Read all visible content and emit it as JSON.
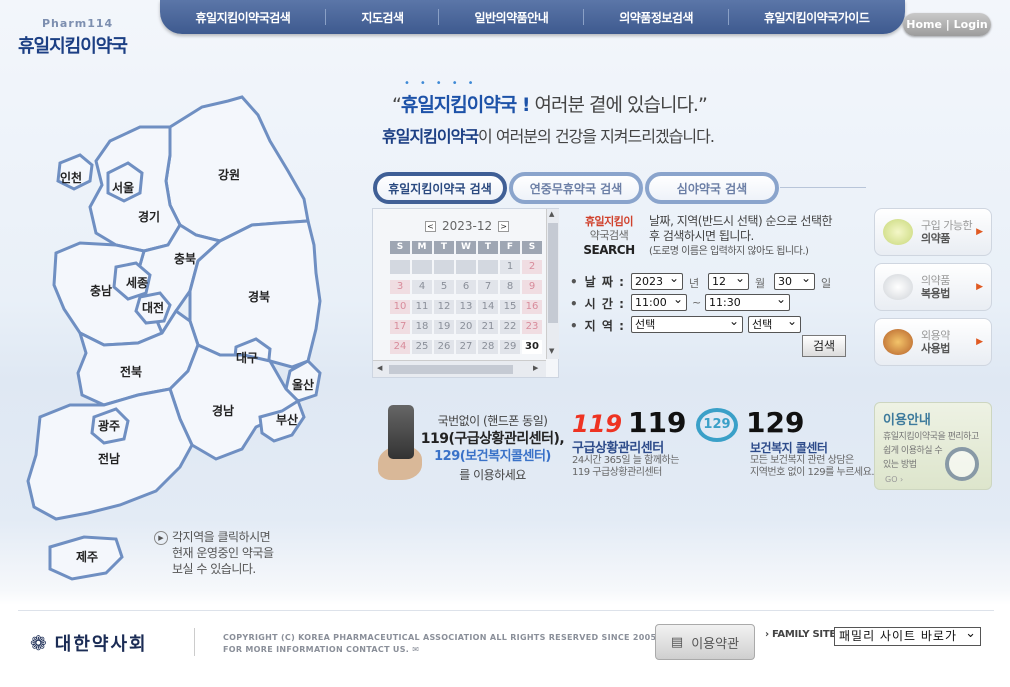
{
  "logo": {
    "sub": "Pharm114",
    "main": "휴일지킴이약국"
  },
  "nav": {
    "items": [
      "휴일지킴이약국검색",
      "지도검색",
      "일반의약품안내",
      "의약품정보검색",
      "휴일지킴이약국가이드"
    ],
    "home_login": "Home | Login"
  },
  "slogan": {
    "line1_pre": "“",
    "line1_highlight": "휴일지킴이약국 !",
    "line1_rest": " 여러분 곁에 있습니다.”",
    "line2_highlight": "휴일지킴이약국",
    "line2_rest": "이 여러분의 건강을 지켜드리겠습니다."
  },
  "tabs": [
    "휴일지킴이약국 검색",
    "연중무휴약국 검색",
    "심야약국 검색"
  ],
  "calendar": {
    "month": "2023-12",
    "prev": "<",
    "next": ">",
    "weekdays": [
      "S",
      "M",
      "T",
      "W",
      "T",
      "F",
      "S"
    ],
    "days": [
      "",
      "",
      "",
      "",
      "",
      "1",
      "2",
      "3",
      "4",
      "5",
      "6",
      "7",
      "8",
      "9",
      "10",
      "11",
      "12",
      "13",
      "14",
      "15",
      "16",
      "17",
      "18",
      "19",
      "20",
      "21",
      "22",
      "23",
      "24",
      "25",
      "26",
      "27",
      "28",
      "29",
      "30"
    ],
    "today": "30"
  },
  "search": {
    "label_l1": "휴일지킴이",
    "label_l2": "약국검색",
    "label_l3": "SEARCH",
    "desc_line1": "날짜, 지역(반드시 선택) 순으로 선택한",
    "desc_line2": "후 검색하시면 됩니다.",
    "desc_line3": "(도로명 이름은 입력하지 않아도 됩니다.)",
    "date_label": "날 짜 :",
    "year": "2023",
    "year_unit": "년",
    "month": "12",
    "month_unit": "월",
    "day": "30",
    "day_unit": "일",
    "time_label": "시 간 :",
    "time_from": "11:00",
    "time_sep": "~",
    "time_to": "11:30",
    "region_label": "지 역 :",
    "region_1": "선택",
    "region_2": "선택",
    "button": "검색"
  },
  "infoboxes": [
    {
      "line1": "구입 가능한",
      "line2": "의약품"
    },
    {
      "line1": "의약품",
      "line2": "복용법"
    },
    {
      "line1": "외용약",
      "line2": "사용법"
    }
  ],
  "emergency": {
    "line1": "국번없이 (핸드폰 동일)",
    "line2": "119(구급상황관리센터),",
    "line3": "129(보건복지콜센터)",
    "line4": "를 이용하세요",
    "logo119": "119",
    "num119": "119",
    "title119": "구급상황관리센터",
    "desc119_1": "24시간 365일 늘 함께하는",
    "desc119_2": "119 구급상황관리센터",
    "logo129": "129",
    "num129": "129",
    "title129": "보건복지 콜센터",
    "desc129_1": "모든 보건복지 관련 상담은",
    "desc129_2": "지역번호 없이 129를 누르세요."
  },
  "guide": {
    "title": "이용안내",
    "desc_line1": "휴일지킴이약국을 편리하고",
    "desc_line2": "쉽게 이용하실 수",
    "desc_line3": "있는 방법",
    "go": "GO ›"
  },
  "map": {
    "regions": {
      "incheon": "인천",
      "seoul": "서울",
      "gyeonggi": "경기",
      "gangwon": "강원",
      "chungbuk": "충북",
      "chungnam": "충남",
      "sejong": "세종",
      "daejeon": "대전",
      "gyeongbuk": "경북",
      "daegu": "대구",
      "jeonbuk": "전북",
      "ulsan": "울산",
      "gyeongnam": "경남",
      "busan": "부산",
      "gwangju": "광주",
      "jeonnam": "전남",
      "jeju": "제주"
    },
    "hint_line1": "각지역을 클릭하시면",
    "hint_line2": "현재 운영중인 약국을",
    "hint_line3": "보실 수 있습니다."
  },
  "footer": {
    "org": "대한약사회",
    "copyright_line1": "COPYRIGHT (C) KOREA PHARMACEUTICAL ASSOCIATION ALL RIGHTS RESERVED SINCE 2005",
    "copyright_line2": "FOR MORE INFORMATION CONTACT US.",
    "terms": "이용약관",
    "family_label": "› FAMILY SITE",
    "family_select": "패밀리 사이트 바로가"
  },
  "colors": {
    "nav_bg": "#3e5a8f",
    "brand_blue": "#1c3f84",
    "region_stroke": "#6f8fc2",
    "accent_red": "#d0412c"
  }
}
